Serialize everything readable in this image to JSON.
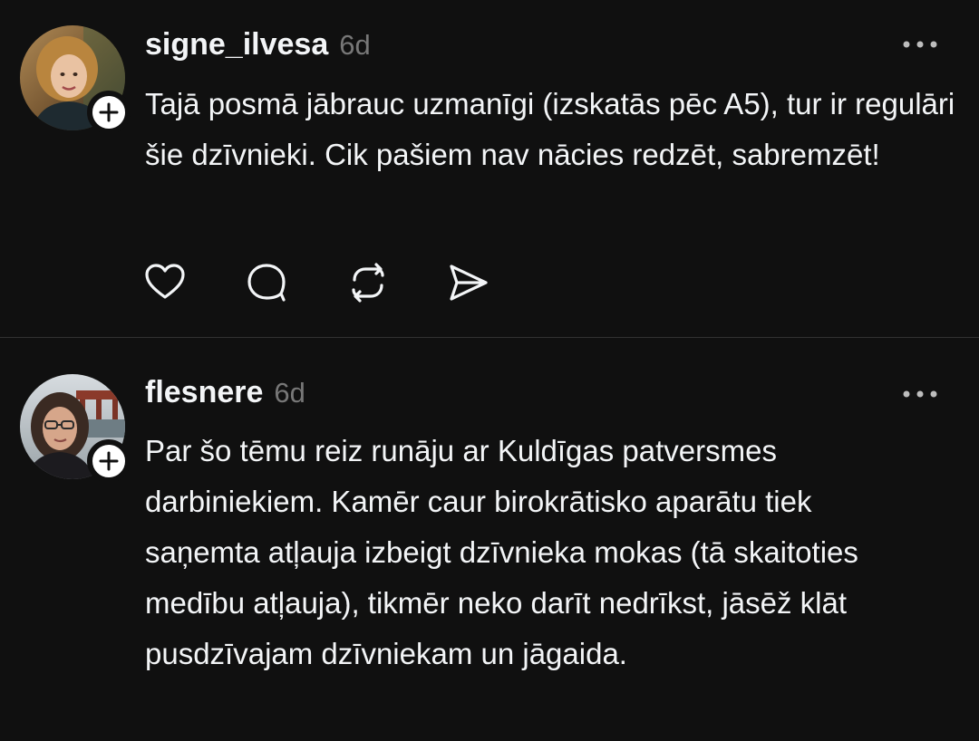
{
  "posts": [
    {
      "username": "signe_ilvesa",
      "time": "6d",
      "text": "Tajā posmā jābrauc uzmanīgi (izskatās pēc A5), tur ir regulāri šie dzīvnieki. Cik pašiem nav nācies redzēt, sabremzēt!",
      "avatar_icon": "avatar-photo",
      "follow_icon": "plus-icon",
      "more_icon": "more-icon",
      "actions": [
        "heart-icon",
        "comment-icon",
        "repost-icon",
        "share-icon"
      ]
    },
    {
      "username": "flesnere",
      "time": "6d",
      "text": "Par šo tēmu reiz runāju ar Kuldīgas patversmes darbiniekiem. Kamēr caur birokrātisko aparātu tiek saņemta atļauja izbeigt dzīvnieka mokas (tā skaitoties medību atļauja), tikmēr neko darīt nedrīkst, jāsēž klāt pusdzīvajam dzīvniekam un jāgaida.",
      "avatar_icon": "avatar-photo",
      "follow_icon": "plus-icon",
      "more_icon": "more-icon"
    }
  ],
  "colors": {
    "background": "#101010",
    "text": "#f3f5f7",
    "muted": "#777777",
    "divider": "#323232"
  }
}
